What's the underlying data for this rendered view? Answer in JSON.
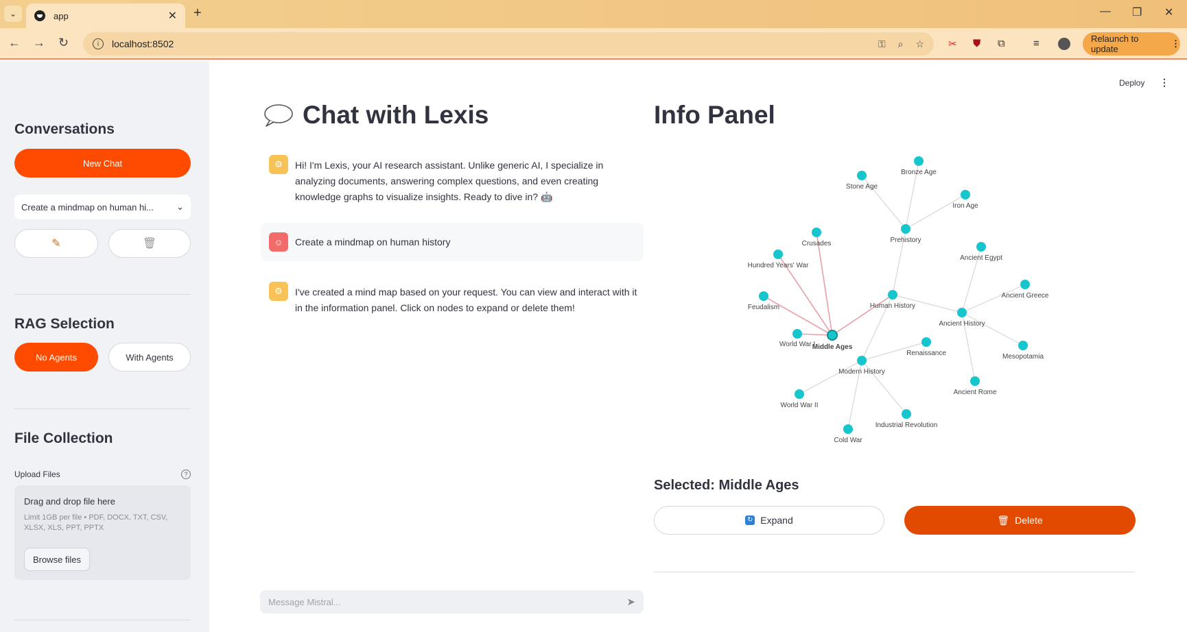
{
  "browser": {
    "tab_title": "app",
    "url": "localhost:8502",
    "relaunch_label": "Relaunch to update"
  },
  "header": {
    "deploy_label": "Deploy"
  },
  "sidebar": {
    "conversations_heading": "Conversations",
    "new_chat_label": "New Chat",
    "selected_conversation": "Create a mindmap on human hi...",
    "rag_heading": "RAG Selection",
    "rag_options": [
      "No Agents",
      "With Agents"
    ],
    "rag_selected": "No Agents",
    "file_heading": "File Collection",
    "upload_label": "Upload Files",
    "dropzone_title": "Drag and drop file here",
    "dropzone_limits": "Limit 1GB per file • PDF, DOCX, TXT, CSV, XLSX, XLS, PPT, PPTX",
    "browse_label": "Browse files"
  },
  "chat": {
    "title": "Chat with Lexis",
    "messages": [
      {
        "role": "assistant",
        "text": "Hi! I'm Lexis, your AI research assistant. Unlike generic AI, I specialize in analyzing documents, answering complex questions, and even creating knowledge graphs to visualize insights. Ready to dive in? 🤖"
      },
      {
        "role": "user",
        "text": "Create a mindmap on human history"
      },
      {
        "role": "assistant",
        "text": "I've created a mind map based on your request. You can view and interact with it in the information panel. Click on nodes to expand or delete them!"
      }
    ],
    "input_placeholder": "Message Mistral..."
  },
  "info_panel": {
    "title": "Info Panel",
    "selected_label": "Selected: Middle Ages",
    "expand_label": "Expand",
    "delete_label": "Delete",
    "graph": {
      "node_color": "#17c5cc",
      "edge_color": "#d7d7d7",
      "highlight_edge_color": "#e8a0a8",
      "nodes": [
        "Bronze Age",
        "Stone Age",
        "Iron Age",
        "Prehistory",
        "Crusades",
        "Hundred Years' War",
        "Ancient Egypt",
        "Ancient Greece",
        "Feudalism",
        "Human History",
        "Ancient History",
        "World War I",
        "Middle Ages",
        "Renaissance",
        "Mesopotamia",
        "Modern History",
        "Ancient Rome",
        "World War II",
        "Industrial Revolution",
        "Cold War"
      ],
      "selected_node": "Middle Ages",
      "edges": [
        [
          "Prehistory",
          "Bronze Age"
        ],
        [
          "Prehistory",
          "Stone Age"
        ],
        [
          "Prehistory",
          "Iron Age"
        ],
        [
          "Human History",
          "Prehistory"
        ],
        [
          "Human History",
          "Ancient History"
        ],
        [
          "Human History",
          "Middle Ages"
        ],
        [
          "Human History",
          "Modern History"
        ],
        [
          "Ancient History",
          "Ancient Egypt"
        ],
        [
          "Ancient History",
          "Ancient Greece"
        ],
        [
          "Ancient History",
          "Mesopotamia"
        ],
        [
          "Ancient History",
          "Ancient Rome"
        ],
        [
          "Middle Ages",
          "Crusades"
        ],
        [
          "Middle Ages",
          "Hundred Years' War"
        ],
        [
          "Middle Ages",
          "Feudalism"
        ],
        [
          "Middle Ages",
          "World War I"
        ],
        [
          "Modern History",
          "Renaissance"
        ],
        [
          "Modern History",
          "World War II"
        ],
        [
          "Modern History",
          "Industrial Revolution"
        ],
        [
          "Modern History",
          "Cold War"
        ]
      ]
    }
  }
}
